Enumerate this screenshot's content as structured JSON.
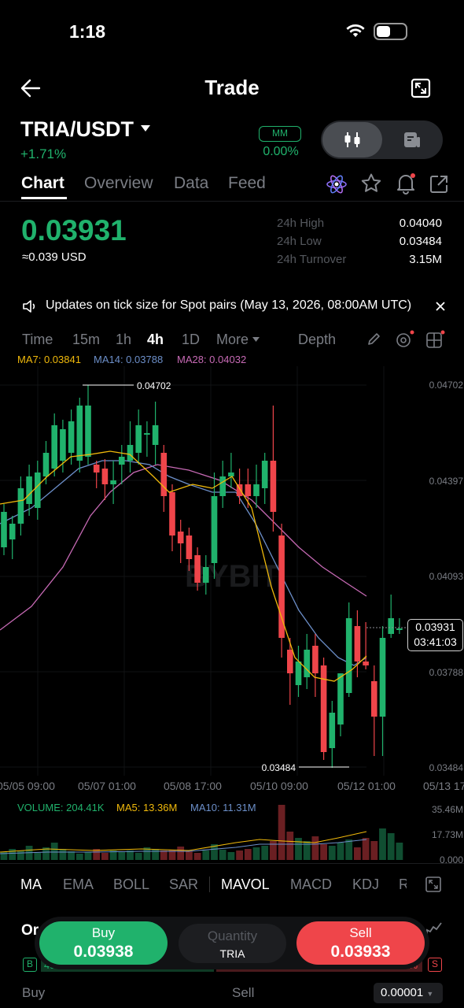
{
  "status_bar": {
    "time": "1:18"
  },
  "header": {
    "title": "Trade"
  },
  "pair": {
    "symbol": "TRIA/USDT",
    "change": "+1.71%",
    "mm_label": "MM",
    "mm_value": "0.00%"
  },
  "tabs": [
    {
      "label": "Chart"
    },
    {
      "label": "Overview"
    },
    {
      "label": "Data"
    },
    {
      "label": "Feed"
    }
  ],
  "price": {
    "last": "0.03931",
    "usd": "≈0.039 USD"
  },
  "stats": [
    {
      "label": "24h High",
      "value": "0.04040"
    },
    {
      "label": "24h Low",
      "value": "0.03484"
    },
    {
      "label": "24h Turnover",
      "value": "3.15M"
    }
  ],
  "notice": {
    "text": "Updates on tick size for Spot pairs (May 13, 2026, 08:00AM UTC)"
  },
  "timeframes": [
    {
      "label": "Time"
    },
    {
      "label": "15m"
    },
    {
      "label": "1h"
    },
    {
      "label": "4h"
    },
    {
      "label": "1D"
    },
    {
      "label": "More"
    },
    {
      "label": "Depth"
    }
  ],
  "ma_legend": {
    "ma7": "MA7: 0.03841",
    "ma14": "MA14: 0.03788",
    "ma28": "MA28: 0.04032"
  },
  "chart": {
    "watermark": "BYBIT",
    "y_axis": [
      "0.04702",
      "0.04397",
      "0.04093",
      "0.03788",
      "0.03484"
    ],
    "x_axis": [
      "05/05 09:00",
      "05/07 01:00",
      "05/08 17:00",
      "05/10 09:00",
      "05/12 01:00",
      "05/13 17"
    ],
    "high_marker": "0.04702",
    "low_marker": "0.03484",
    "current_price": "0.03931",
    "countdown": "03:41:03",
    "colors": {
      "up": "#20b26c",
      "down": "#ef454a",
      "ma7": "#f0b90b",
      "ma14": "#6c8fc9",
      "ma28": "#c76ab5"
    }
  },
  "volume": {
    "legend": {
      "vol": "VOLUME: 204.41K",
      "ma5": "MA5: 13.36M",
      "ma10": "MA10: 11.31M"
    },
    "y_axis": [
      "35.46M",
      "17.73M",
      "0.000"
    ]
  },
  "indicators": [
    {
      "label": "MA"
    },
    {
      "label": "EMA"
    },
    {
      "label": "BOLL"
    },
    {
      "label": "SAR"
    },
    {
      "label": "MAVOL"
    },
    {
      "label": "MACD"
    },
    {
      "label": "KDJ"
    },
    {
      "label": "R"
    }
  ],
  "order_book": {
    "peek_label": "Or",
    "buy_tag": "B",
    "sell_tag": "S",
    "buy_pct": "48%",
    "sell_pct": "51%",
    "buy_col": "Buy",
    "sell_col": "Sell",
    "precision": "0.00001"
  },
  "actions": {
    "buy_label": "Buy",
    "buy_price": "0.03938",
    "qty_label": "Quantity",
    "qty_unit": "TRIA",
    "sell_label": "Sell",
    "sell_price": "0.03933"
  }
}
